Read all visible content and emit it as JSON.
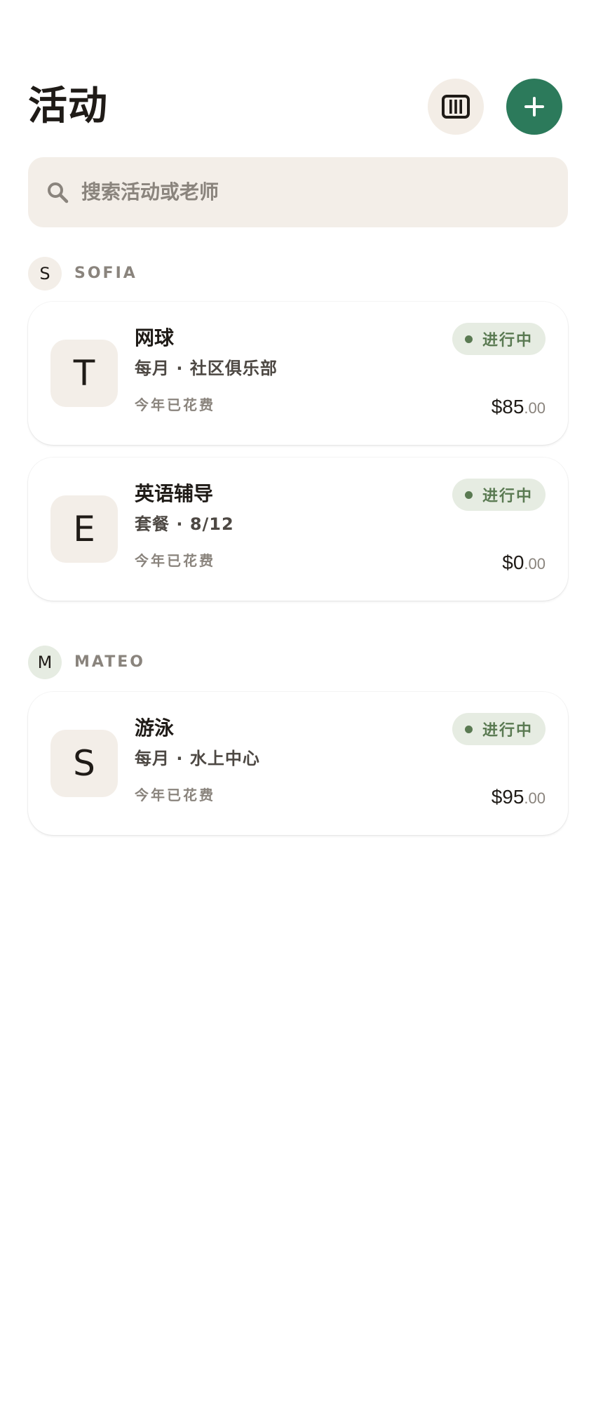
{
  "header": {
    "title": "活动",
    "calendar_icon": "calendar-icon",
    "add_icon": "plus-icon"
  },
  "search": {
    "placeholder": "搜索活动或老师"
  },
  "colors": {
    "accent": "#2c7a5b",
    "status": "#5a7a52",
    "surface": "#f3eee8"
  },
  "groups": [
    {
      "person_initial": "S",
      "person_name": "SOFIA",
      "activities": [
        {
          "logo_letter": "T",
          "title": "网球",
          "subtitle": "每月 · 社区俱乐部",
          "spent_label": "今年已花费",
          "status": "进行中",
          "amount_main": "$85",
          "amount_cents": ".00"
        },
        {
          "logo_letter": "E",
          "title": "英语辅导",
          "subtitle": "套餐 · 8/12",
          "spent_label": "今年已花费",
          "status": "进行中",
          "amount_main": "$0",
          "amount_cents": ".00"
        }
      ]
    },
    {
      "person_initial": "M",
      "person_name": "MATEO",
      "activities": [
        {
          "logo_letter": "S",
          "title": "游泳",
          "subtitle": "每月 · 水上中心",
          "spent_label": "今年已花费",
          "status": "进行中",
          "amount_main": "$95",
          "amount_cents": ".00"
        }
      ]
    }
  ]
}
